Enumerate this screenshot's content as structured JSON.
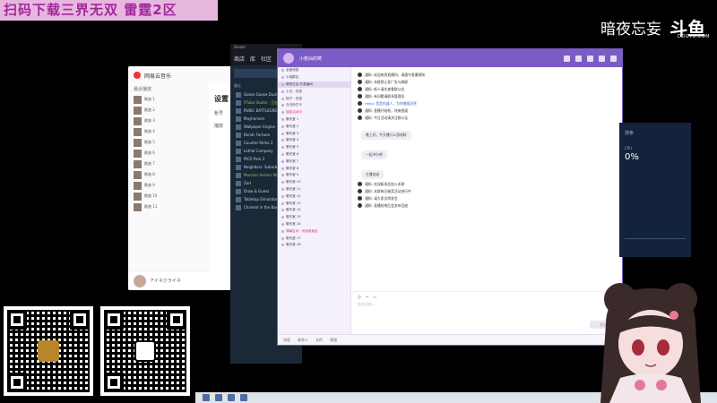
{
  "overlay": {
    "banner_text": "扫码下载三界无双 雷霆2区",
    "douyu_text": "暗夜忘妄",
    "douyu_logo": "斗鱼",
    "douyu_url": "DOUYU.COM"
  },
  "music": {
    "app_name": "网易云音乐",
    "section_label": "最近播放",
    "tracks": [
      "歌曲 1",
      "歌曲 2",
      "歌曲 3",
      "歌曲 4",
      "歌曲 5",
      "歌曲 6",
      "歌曲 7",
      "歌曲 8",
      "歌曲 9",
      "歌曲 10",
      "歌曲 11"
    ],
    "now_playing": "アイネクライネ"
  },
  "settings": {
    "title": "设置",
    "items": [
      "账号",
      "播放"
    ]
  },
  "steam": {
    "titlebar": "Steam",
    "nav": [
      "商店",
      "库",
      "社区"
    ],
    "category_recent": "最近",
    "games": [
      {
        "name": "Goose Goose Duck",
        "state": "normal"
      },
      {
        "name": "VTube Studio - 正在运行",
        "state": "green"
      },
      {
        "name": "PUBG: BATTLEGROUNDS",
        "state": "normal"
      },
      {
        "name": "Mayhemers",
        "state": "normal"
      },
      {
        "name": "Wallpaper Engine",
        "state": "normal"
      },
      {
        "name": "Bonds Fortune",
        "state": "normal"
      },
      {
        "name": "Counter-Strike 2",
        "state": "normal"
      },
      {
        "name": "Lethal Company",
        "state": "normal"
      },
      {
        "name": "PICO Park 2",
        "state": "normal"
      },
      {
        "name": "Neighbors: Suburban",
        "state": "normal"
      },
      {
        "name": "Monster Hunter Wilds",
        "state": "green"
      },
      {
        "name": "Zort",
        "state": "normal"
      },
      {
        "name": "Draw & Guess",
        "state": "normal"
      },
      {
        "name": "Tabletop Simulator",
        "state": "normal"
      },
      {
        "name": "Chained in the Back",
        "state": "normal"
      }
    ]
  },
  "qq": {
    "group_name": "小桃仙的窝",
    "left_rows": [
      {
        "text": "全部消息",
        "style": "normal"
      },
      {
        "text": "小桃群友",
        "style": "normal"
      },
      {
        "text": "暗夜忘妄 的直播间",
        "style": "sel"
      },
      {
        "text": "小白 - 在线",
        "style": "normal"
      },
      {
        "text": "桃子 - 在线",
        "style": "normal"
      },
      {
        "text": "今日份打卡",
        "style": "normal"
      },
      {
        "text": "抽奖活动中",
        "style": "red"
      },
      {
        "text": "聊天室 1",
        "style": "normal"
      },
      {
        "text": "聊天室 2",
        "style": "normal"
      },
      {
        "text": "聊天室 3",
        "style": "normal"
      },
      {
        "text": "聊天室 4",
        "style": "normal"
      },
      {
        "text": "聊天室 5",
        "style": "normal"
      },
      {
        "text": "聊天室 6",
        "style": "normal"
      },
      {
        "text": "聊天室 7",
        "style": "normal"
      },
      {
        "text": "聊天室 8",
        "style": "normal"
      },
      {
        "text": "聊天室 9",
        "style": "normal"
      },
      {
        "text": "聊天室 10",
        "style": "normal"
      },
      {
        "text": "聊天室 11",
        "style": "normal"
      },
      {
        "text": "聊天室 12",
        "style": "normal"
      },
      {
        "text": "聊天室 13",
        "style": "normal"
      },
      {
        "text": "聊天室 14",
        "style": "normal"
      },
      {
        "text": "聊天室 15",
        "style": "normal"
      },
      {
        "text": "聊天室 16",
        "style": "normal"
      },
      {
        "text": "弹幕互动 · 欢迎新朋友",
        "style": "red"
      },
      {
        "text": "聊天室 17",
        "style": "normal"
      },
      {
        "text": "聊天室 18",
        "style": "normal"
      }
    ],
    "messages": [
      {
        "text": "通知: 欢迎来到直播间，请遵守直播规则",
        "style": "normal"
      },
      {
        "text": "通知: 本群禁止发广告与刷屏",
        "style": "normal"
      },
      {
        "text": "通知: 新人请先查看群公告",
        "style": "normal"
      },
      {
        "text": "通知: 有问题请联系管理员",
        "style": "normal"
      },
      {
        "text": "Hello! 我是机器人，为你播报消息",
        "style": "link"
      },
      {
        "text": "通知: 直播开始啦，快来围观",
        "style": "normal"
      },
      {
        "text": "通知: 今日活动请关注群公告",
        "style": "normal"
      }
    ],
    "bubbles": [
      "晚上好，今天播什么游戏呀",
      "一起冲分吧",
      "主播加油"
    ],
    "messages2": [
      {
        "text": "通知: 欢迎新成员加入本群",
        "style": "normal"
      },
      {
        "text": "通知: 本群每日抽奖活动进行中",
        "style": "normal"
      },
      {
        "text": "通知: 请大家文明发言",
        "style": "normal"
      },
      {
        "text": "通知: 直播结束后会发布回放",
        "style": "normal"
      }
    ],
    "composer_placeholder": "发送消息...",
    "send_label": "发送",
    "bottom_tabs": [
      "消息",
      "联系人",
      "文件",
      "频道"
    ]
  },
  "rpanel": {
    "search_label": "搜索",
    "stat_label": "CPU",
    "stat_value": "0%"
  }
}
